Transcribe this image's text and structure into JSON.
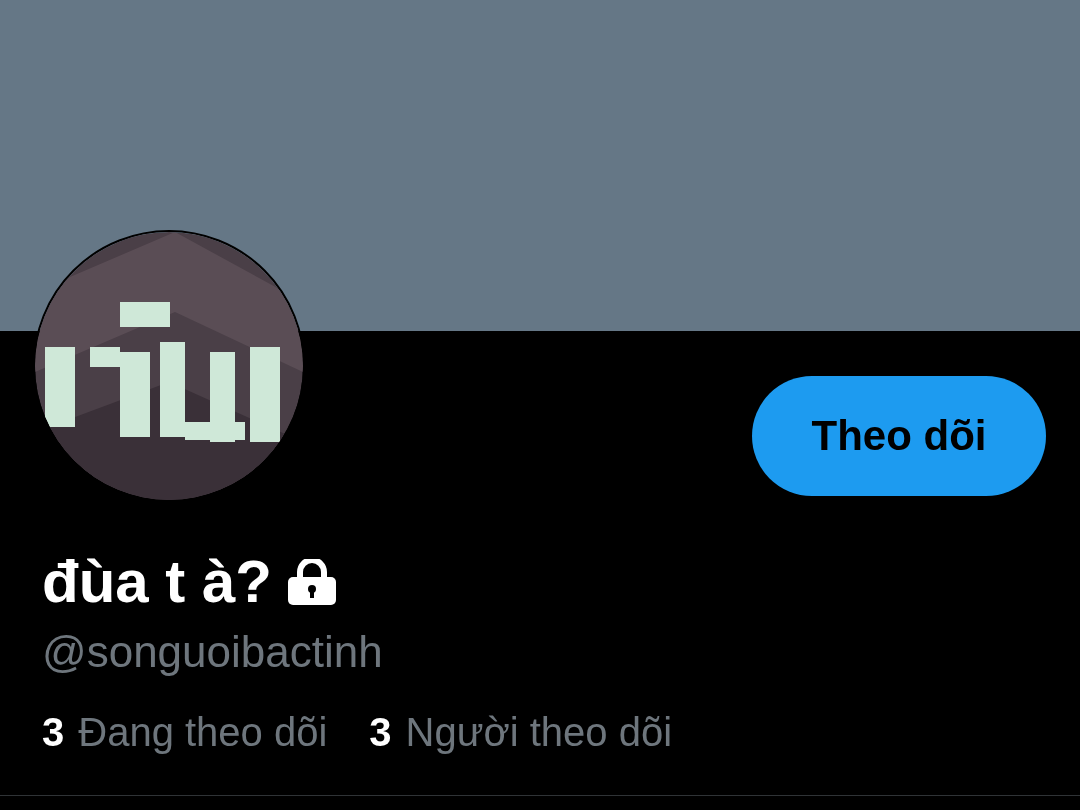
{
  "banner": {
    "kind": "plain"
  },
  "profile": {
    "follow_button": "Theo dõi",
    "name": "đùa t à?",
    "protected": true,
    "handle": "@songuoibactinh"
  },
  "stats": [
    {
      "count": "3",
      "label": "Đang theo dõi"
    },
    {
      "count": "3",
      "label": "Người theo dõi"
    }
  ]
}
